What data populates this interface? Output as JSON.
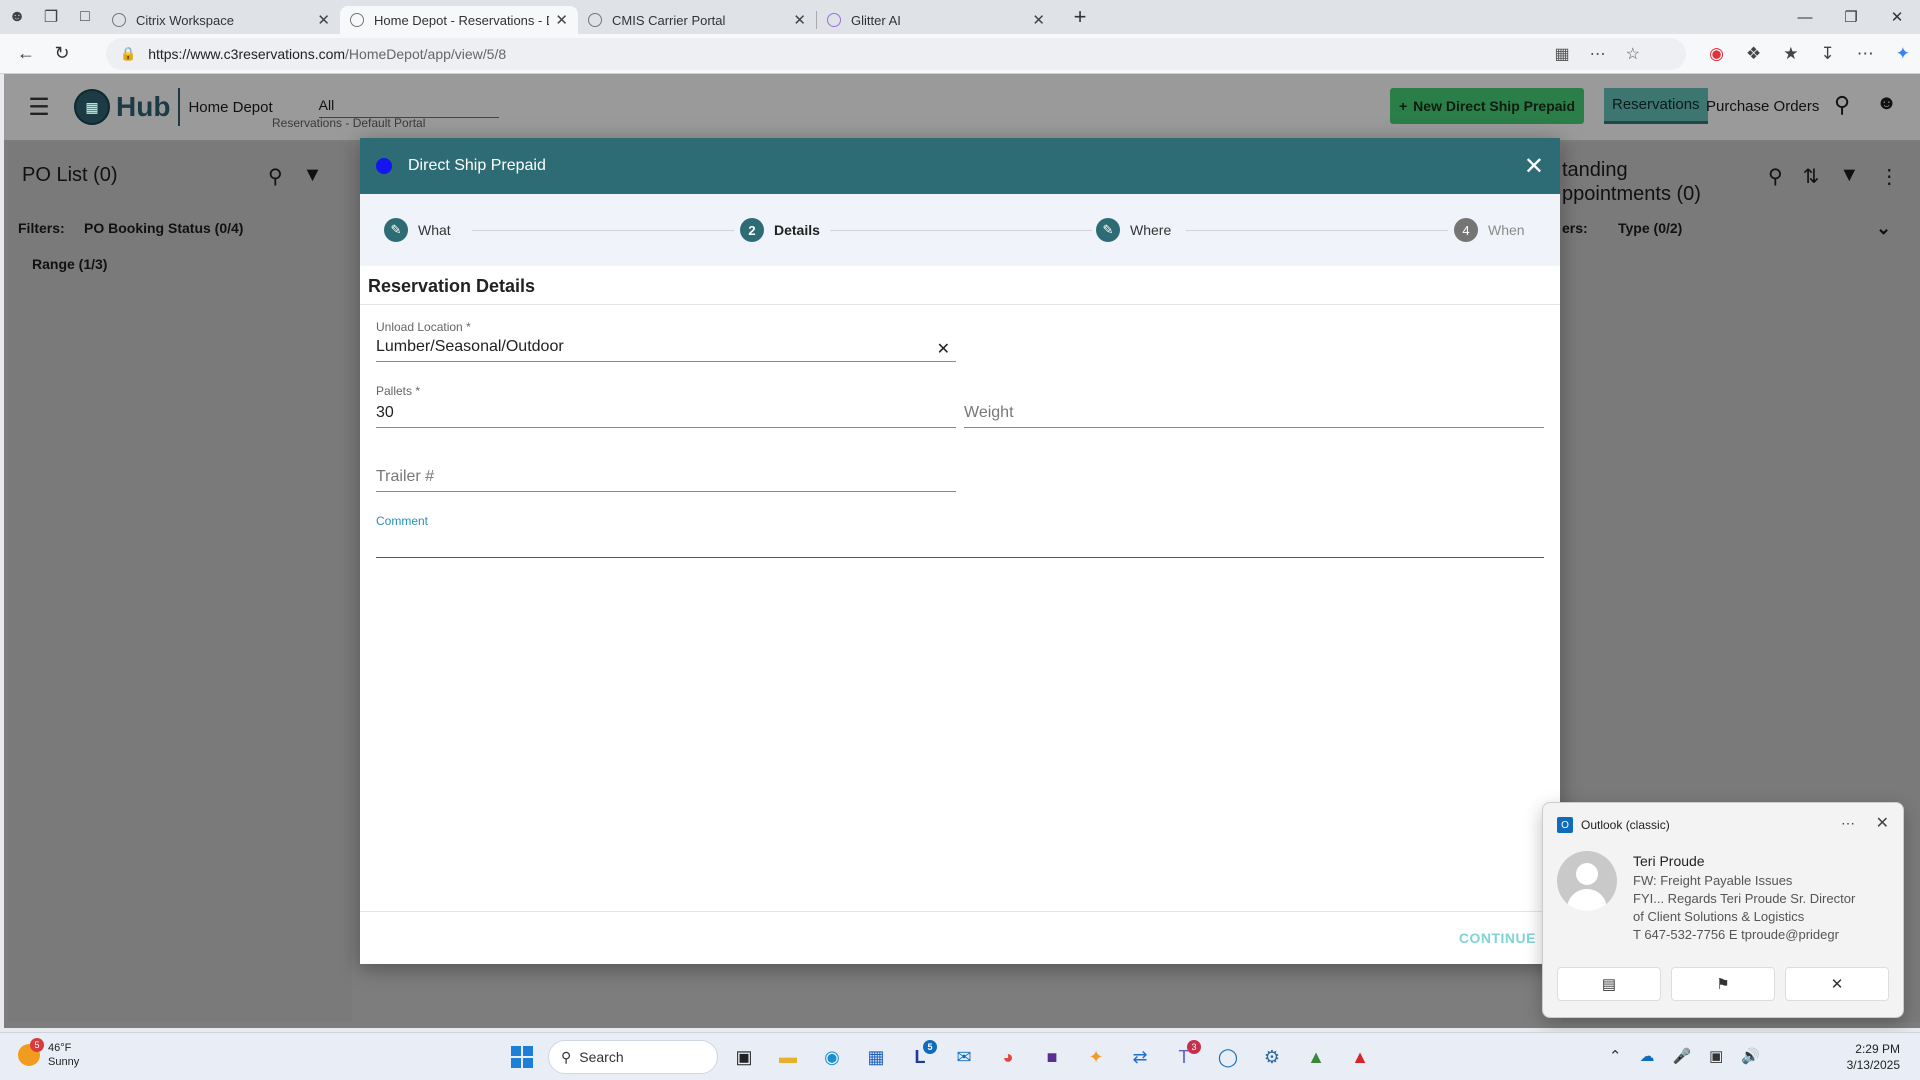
{
  "browser": {
    "tabs": [
      {
        "title": "Citrix Workspace",
        "active": false
      },
      {
        "title": "Home Depot - Reservations - Def",
        "active": true
      },
      {
        "title": "CMIS Carrier Portal",
        "active": false
      },
      {
        "title": "Glitter AI",
        "active": false
      }
    ],
    "url_host": "https://www.c3reservations.com",
    "url_path": "/HomeDepot/app/view/5/8"
  },
  "app": {
    "logo_text": "Hub",
    "company": "Home Depot",
    "portal_value": "All",
    "portal_sub": "Reservations - Default Portal",
    "new_button": "New Direct Ship Prepaid",
    "nav_reservations": "Reservations",
    "nav_purchase_orders": "Purchase Orders"
  },
  "left_panel": {
    "title": "PO List (0)",
    "filters_label": "Filters:",
    "filter1": "PO Booking Status (0/4)",
    "filter2": "Range (1/3)"
  },
  "right_panel": {
    "title_line1": "tanding",
    "title_line2": "ppointments (0)",
    "filters_label": "ers:",
    "filter1": "Type (0/2)"
  },
  "dialog": {
    "title": "Direct Ship Prepaid",
    "steps": [
      {
        "label": "What",
        "marker": "✎",
        "state": "done"
      },
      {
        "label": "Details",
        "marker": "2",
        "state": "active"
      },
      {
        "label": "Where",
        "marker": "✎",
        "state": "done"
      },
      {
        "label": "When",
        "marker": "4",
        "state": "disabled"
      }
    ],
    "section_title": "Reservation Details",
    "unload_label": "Unload Location *",
    "unload_value": "Lumber/Seasonal/Outdoor",
    "pallets_label": "Pallets *",
    "pallets_value": "30",
    "weight_placeholder": "Weight",
    "trailer_placeholder": "Trailer #",
    "comment_label": "Comment",
    "continue_label": "CONTINUE"
  },
  "toast": {
    "app": "Outlook (classic)",
    "from": "Teri  Proude",
    "lines": [
      "FW: Freight Payable Issues",
      "FYI...  Regards  Teri Proude   Sr. Director",
      "of Client Solutions & Logistics",
      "T 647-532-7756        E tproude@pridegr"
    ]
  },
  "taskbar": {
    "temp": "46°F",
    "condition": "Sunny",
    "weather_badge": "5",
    "search_placeholder": "Search",
    "time": "2:29 PM",
    "date": "3/13/2025",
    "badges": {
      "l_app": "5",
      "teams": "3"
    }
  },
  "colors": {
    "dialog_header": "#2d6c74",
    "new_button": "#2c7e48",
    "continue": "#7fd4d8"
  }
}
